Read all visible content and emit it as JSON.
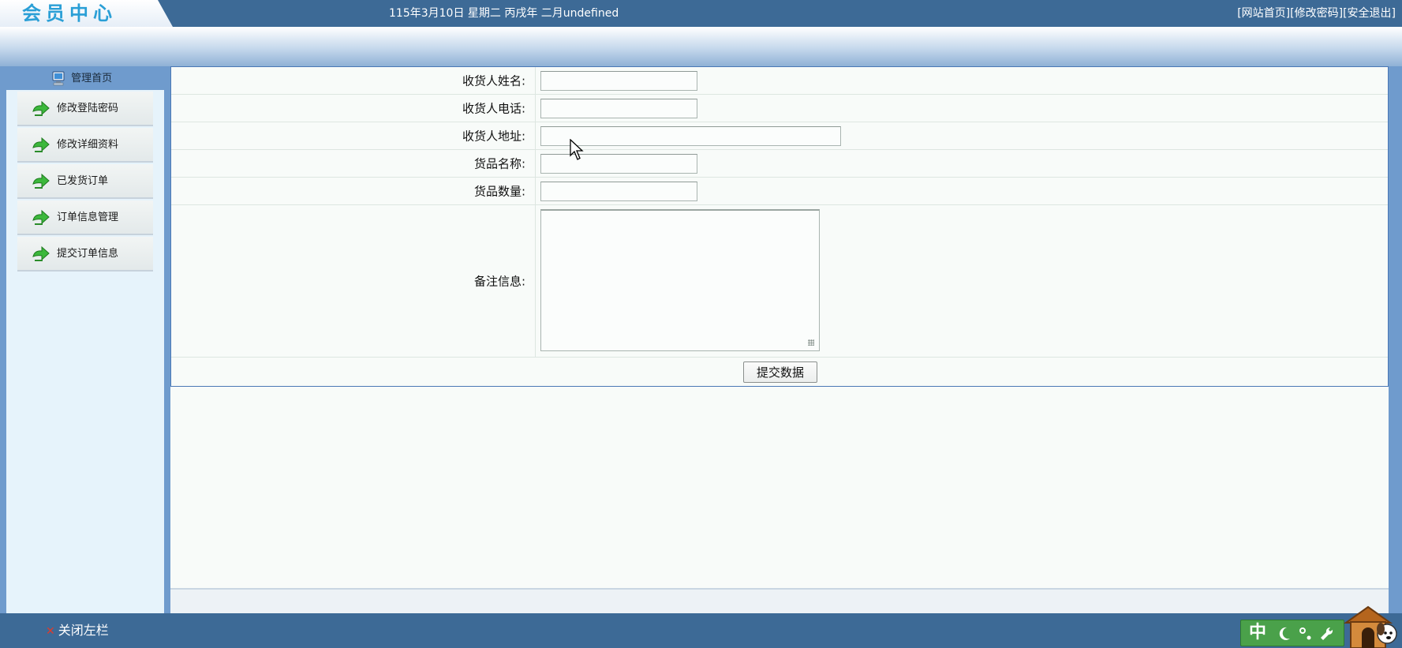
{
  "header": {
    "logo_text": "会员中心",
    "date_text": "115年3月10日 星期二 丙戌年 二月undefined",
    "links": [
      "[网站首页]",
      "[修改密码]",
      "[安全退出]"
    ]
  },
  "sidebar": {
    "home_label": "管理首页",
    "items": [
      {
        "label": "修改登陆密码",
        "icon": "green-arrow-icon"
      },
      {
        "label": "修改详细资料",
        "icon": "green-arrow-icon"
      },
      {
        "label": "已发货订单",
        "icon": "green-arrow-icon"
      },
      {
        "label": "订单信息管理",
        "icon": "green-arrow-icon"
      },
      {
        "label": "提交订单信息",
        "icon": "green-arrow-icon"
      }
    ]
  },
  "form": {
    "fields": [
      {
        "label": "收货人姓名:",
        "value": ""
      },
      {
        "label": "收货人电话:",
        "value": ""
      },
      {
        "label": "收货人地址:",
        "value": ""
      },
      {
        "label": "货品名称:",
        "value": ""
      },
      {
        "label": "货品数量:",
        "value": ""
      }
    ],
    "remark_label": "备注信息:",
    "remark_value": "",
    "submit_label": "提交数据"
  },
  "footer": {
    "close_left_label": "关闭左栏",
    "close_icon": "x-icon"
  },
  "tray": {
    "ime_char": "中",
    "icons": [
      "moon-icon",
      "punctuation-icon",
      "wrench-icon",
      "doghouse-mascot-icon"
    ]
  },
  "colors": {
    "header_bg": "#3d6a96",
    "frame_blue": "#6f9bcd",
    "sidebar_bg": "#e6f3fb",
    "content_bg": "#f8fbf9",
    "form_border": "#4a78b6",
    "logo_text": "#2a9fd6",
    "ime_green": "#4aa14a"
  }
}
